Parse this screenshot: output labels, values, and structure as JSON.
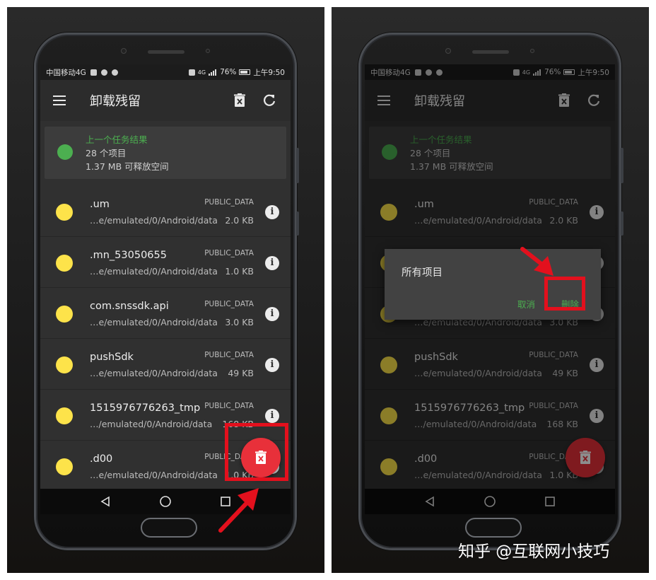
{
  "status_bar": {
    "carrier": "中国移动4G",
    "signal": "4G",
    "battery": "76%",
    "time": "上午9:50"
  },
  "toolbar": {
    "title": "卸载残留"
  },
  "summary": {
    "heading": "上一个任务结果",
    "count": "28 个项目",
    "space": "1.37 MB 可释放空间"
  },
  "items": [
    {
      "name": ".um",
      "path": "…e/emulated/0/Android/data",
      "type": "PUBLIC_DATA",
      "size": "2.0 KB"
    },
    {
      "name": ".mn_53050655",
      "path": "…e/emulated/0/Android/data",
      "type": "PUBLIC_DATA",
      "size": "1.0 KB"
    },
    {
      "name": "com.snssdk.api",
      "path": "…e/emulated/0/Android/data",
      "type": "PUBLIC_DATA",
      "size": "3.0 KB"
    },
    {
      "name": "pushSdk",
      "path": "…e/emulated/0/Android/data",
      "type": "PUBLIC_DATA",
      "size": "49 KB"
    },
    {
      "name": "1515976776263_tmp",
      "path": "…/emulated/0/Android/data",
      "type": "PUBLIC_DATA",
      "size": "168 KB"
    },
    {
      "name": ".d00",
      "path": "…e/emulated/0/Android/data",
      "type": "PUBLIC_DATA",
      "size": "1.0 KB"
    }
  ],
  "dialog": {
    "title": "所有项目",
    "cancel": "取消",
    "delete": "删除"
  },
  "watermark": "知乎 @互联网小技巧",
  "colors": {
    "accent_green": "#4caf50",
    "item_yellow": "#fde34a",
    "fab_red": "#e8303a",
    "highlight_red": "#e3101d"
  }
}
